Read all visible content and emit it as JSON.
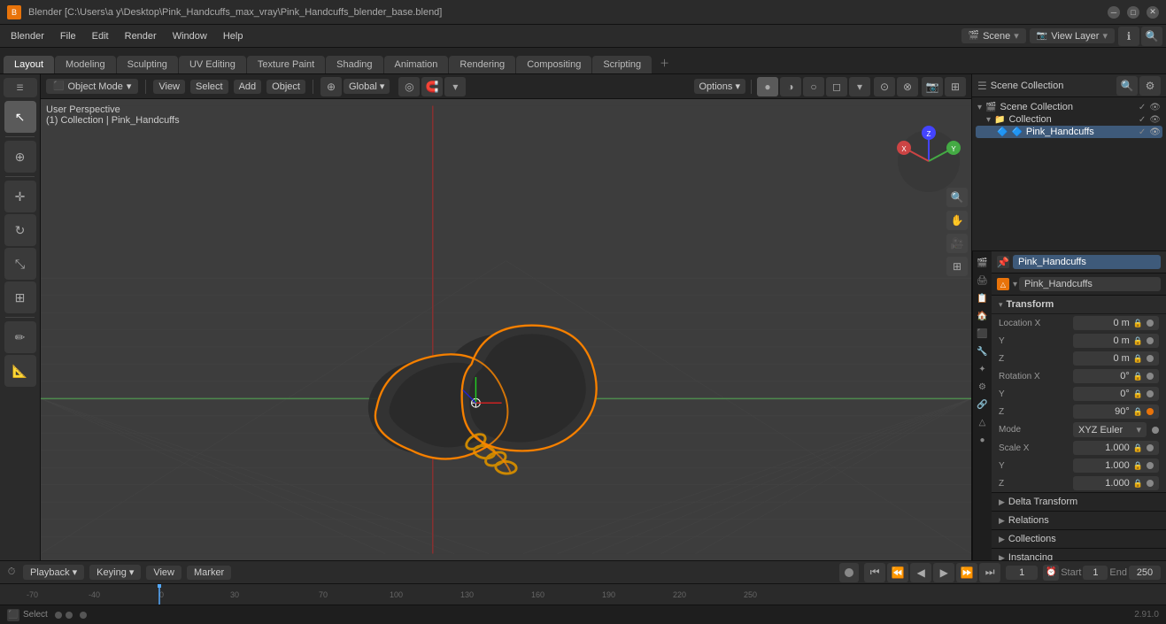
{
  "titlebar": {
    "title": "Blender [C:\\Users\\a y\\Desktop\\Pink_Handcuffs_max_vray\\Pink_Handcuffs_blender_base.blend]",
    "icon": "B"
  },
  "menubar": {
    "items": [
      "Blender",
      "File",
      "Edit",
      "Render",
      "Window",
      "Help"
    ],
    "scene_label": "Scene",
    "view_layer_label": "View Layer"
  },
  "workspaces": {
    "tabs": [
      "Layout",
      "Modeling",
      "Sculpting",
      "UV Editing",
      "Texture Paint",
      "Shading",
      "Animation",
      "Rendering",
      "Compositing",
      "Scripting"
    ],
    "active": "Layout"
  },
  "viewport": {
    "mode": "Object Mode",
    "menus": [
      "View",
      "Select",
      "Add",
      "Object"
    ],
    "transform": "Global",
    "info_line1": "User Perspective",
    "info_line2": "(1) Collection | Pink_Handcuffs"
  },
  "scene_collection": {
    "title": "Scene Collection",
    "collection": "Collection",
    "object": "Pink_Handcuffs"
  },
  "properties": {
    "active_object": "Pink_Handcuffs",
    "mesh_name": "Pink_Handcuffs",
    "transform": {
      "title": "Transform",
      "location_x": "0 m",
      "location_y": "0 m",
      "location_z": "0 m",
      "rotation_x": "0°",
      "rotation_y": "0°",
      "rotation_z": "90°",
      "mode": "XYZ Euler",
      "scale_x": "1.000",
      "scale_y": "1.000",
      "scale_z": "1.000"
    },
    "sections": [
      "Delta Transform",
      "Relations",
      "Collections",
      "Instancing"
    ]
  },
  "timeline": {
    "playback_label": "Playback",
    "keying_label": "Keying",
    "view_label": "View",
    "marker_label": "Marker",
    "current_frame": "1",
    "start_frame": "1",
    "end_frame": "250"
  },
  "statusbar": {
    "left": "Select",
    "version": "2.91.0"
  },
  "colors": {
    "accent": "#e8730a",
    "selected": "#3e5a7a",
    "bg_dark": "#1a1a1a",
    "bg_mid": "#252525",
    "bg_light": "#3a3a3a",
    "active_object_color": "#ff8800"
  }
}
